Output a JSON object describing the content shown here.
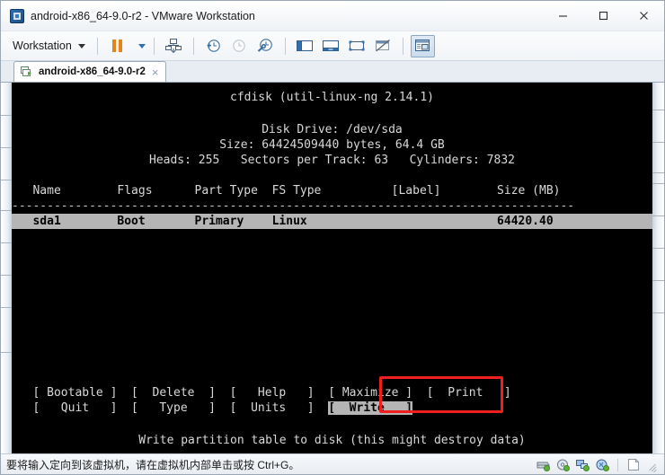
{
  "window": {
    "title": "android-x86_64-9.0-r2 - VMware Workstation",
    "app_icon": "vmware-icon",
    "controls": {
      "minimize": "minimize-icon",
      "maximize": "maximize-icon",
      "close": "close-icon"
    }
  },
  "toolbar": {
    "menu_label": "Workstation",
    "buttons": [
      "pause-vm-button",
      "power-dropdown-button",
      "manage-vm-button",
      "take-snapshot-button",
      "revert-snapshot-button",
      "snapshot-manager-button",
      "show-library-button",
      "show-console-view-button",
      "enter-full-screen-button",
      "unity-mode-button",
      "show-thumbnails-button"
    ]
  },
  "tab": {
    "label": "android-x86_64-9.0-r2",
    "close_label": "×",
    "icon": "vm-tab-icon"
  },
  "console": {
    "title": "cfdisk (util-linux-ng 2.14.1)",
    "disk_drive": "Disk Drive: /dev/sda",
    "size": "Size: 64424509440 bytes, 64.4 GB",
    "geometry": "Heads: 255   Sectors per Track: 63   Cylinders: 7832",
    "columns_line": "   Name        Flags      Part Type  FS Type          [Label]        Size (MB)",
    "divider": "--------------------------------------------------------------------------------",
    "partition_row": "   sda1        Boot       Primary    Linux                           64420.40",
    "partition": {
      "name": "sda1",
      "flags": "Boot",
      "part_type": "Primary",
      "fs_type": "Linux",
      "label": "",
      "size_mb": "64420.40"
    },
    "menu_row1_pre": "   [ Bootable ]  [  Delete  ]  [   Help   ]  ",
    "menu_row1_maximize": "[ Maximize ]",
    "menu_row1_post": "  [  Print   ]",
    "menu_row2_pre": "   [   Quit   ]  [   Type   ]  [  Units   ]  ",
    "menu_row2_write": "[  Write   ]",
    "menu_row2_post": "",
    "help_text": "Write partition table to disk (this might destroy data)",
    "annotation_color": "#ef1f1f"
  },
  "statusbar": {
    "message": "要将输入定向到该虚拟机，请在虚拟机内部单击或按 Ctrl+G。",
    "icons": [
      "hard-disk-icon",
      "cd-dvd-icon",
      "network-adapter-icon",
      "sound-card-icon",
      "printer-icon"
    ]
  }
}
